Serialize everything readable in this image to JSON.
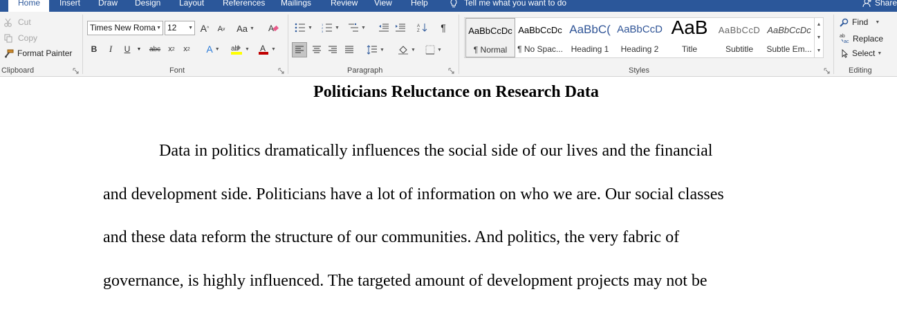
{
  "tabs": [
    {
      "label": "Home",
      "active": true
    },
    {
      "label": "Insert"
    },
    {
      "label": "Draw"
    },
    {
      "label": "Design"
    },
    {
      "label": "Layout"
    },
    {
      "label": "References"
    },
    {
      "label": "Mailings"
    },
    {
      "label": "Review"
    },
    {
      "label": "View"
    },
    {
      "label": "Help"
    }
  ],
  "tell_me": {
    "placeholder": "Tell me what you want to do"
  },
  "share_label": "Share",
  "clipboard": {
    "label": "Clipboard",
    "cut": "Cut",
    "copy": "Copy",
    "format_painter": "Format Painter"
  },
  "font": {
    "label": "Font",
    "family": "Times New Roma",
    "size": "12",
    "change_case": "Aa",
    "font_color": "#c00000",
    "highlight_color": "#ffff00"
  },
  "paragraph": {
    "label": "Paragraph"
  },
  "styles": {
    "label": "Styles",
    "items": [
      {
        "preview": "AaBbCcDc",
        "name": "¶ Normal",
        "selected": true
      },
      {
        "preview": "AaBbCcDc",
        "name": "¶ No Spac..."
      },
      {
        "preview": "AaBbC(",
        "name": "Heading 1"
      },
      {
        "preview": "AaBbCcD",
        "name": "Heading 2"
      },
      {
        "preview": "AaB",
        "name": "Title"
      },
      {
        "preview": "AaBbCcD",
        "name": "Subtitle"
      },
      {
        "preview": "AaBbCcDc",
        "name": "Subtle Em..."
      }
    ]
  },
  "editing": {
    "label": "Editing",
    "find": "Find",
    "replace": "Replace",
    "select": "Select"
  },
  "colors": {
    "accent": "#2b579a",
    "ribbon_bg": "#f3f3f3"
  },
  "document": {
    "title": "Politicians Reluctance on Research Data",
    "lines": [
      "Data in politics dramatically influences the social side of our lives and the financial",
      "and development side. Politicians have a lot of information on who we are. Our social classes",
      "and these data reform the structure of our communities. And politics, the very fabric of",
      "governance, is highly influenced. The targeted amount of development projects may not be"
    ]
  }
}
